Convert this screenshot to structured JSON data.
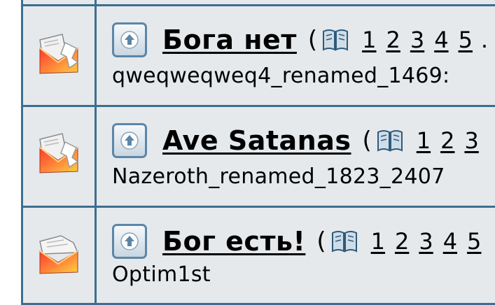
{
  "topics": [
    {
      "title": "Бога нет",
      "open_paren": "(",
      "pages": [
        "1",
        "2",
        "3",
        "4",
        "5"
      ],
      "trailing": ".",
      "author": "qweqweqweq4_renamed_1469:"
    },
    {
      "title": "Ave Satanas",
      "open_paren": "(",
      "pages": [
        "1",
        "2",
        "3"
      ],
      "trailing": "",
      "author": "Nazeroth_renamed_1823_2407"
    },
    {
      "title": "Бог есть!",
      "open_paren": "(",
      "pages": [
        "1",
        "2",
        "3",
        "4",
        "5"
      ],
      "trailing": "",
      "author": "Optim1st"
    }
  ],
  "colors": {
    "border": "#3d6e8f",
    "row_background": "#e5e9ec",
    "button_border": "#5b86a8"
  },
  "icons": {
    "row_icon": "envelope-icon",
    "up_button_icon": "up-arrow-icon",
    "pages_icon": "book-pages-icon"
  }
}
